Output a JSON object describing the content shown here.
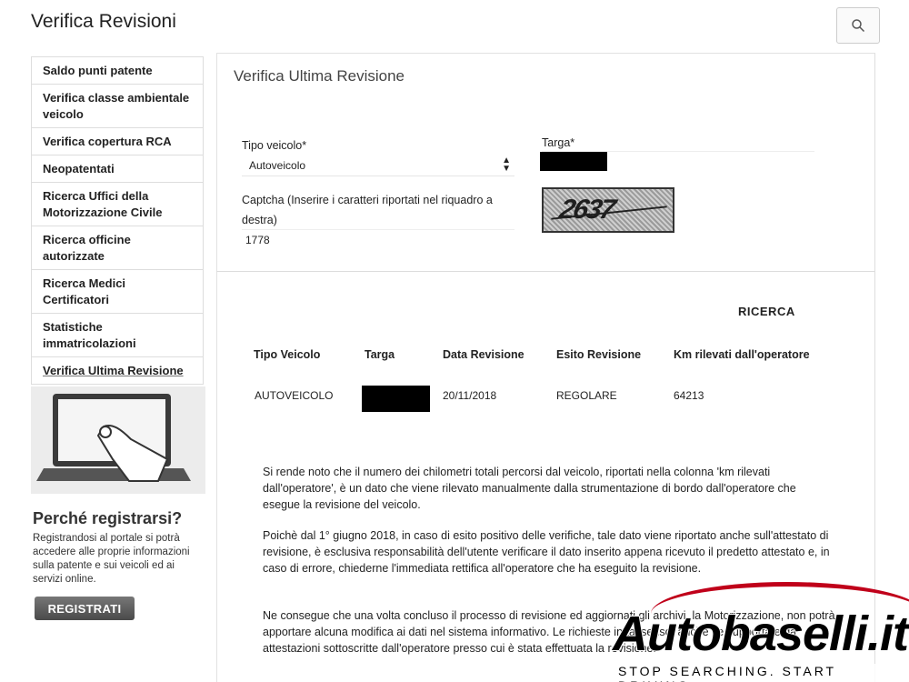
{
  "header": {
    "title": "Verifica Revisioni",
    "search_icon": "search-icon"
  },
  "sidebar": {
    "items": [
      {
        "label": "Saldo punti patente"
      },
      {
        "label": "Verifica classe ambientale veicolo"
      },
      {
        "label": "Verifica copertura RCA"
      },
      {
        "label": "Neopatentati"
      },
      {
        "label": "Ricerca Uffici della Motorizzazione Civile"
      },
      {
        "label": "Ricerca officine autorizzate"
      },
      {
        "label": "Ricerca Medici Certificatori"
      },
      {
        "label": "Statistiche immatricolazioni"
      },
      {
        "label": "Verifica Ultima Revisione"
      }
    ],
    "why_title": "Perché registrarsi?",
    "why_text": "Registrandosi al portale si potrà accedere alle proprie informazioni sulla patente e sui veicoli ed ai servizi online.",
    "register_label": "REGISTRATI"
  },
  "form": {
    "title": "Verifica Ultima Revisione",
    "tipo_label": "Tipo veicolo*",
    "tipo_value": "Autoveicolo",
    "targa_label": "Targa*",
    "captcha_label": "Captcha (Inserire i caratteri riportati nel riquadro a destra)",
    "captcha_value": "1778",
    "captcha_image_text": "2637",
    "search_label": "RICERCA"
  },
  "results": {
    "columns": [
      "Tipo Veicolo",
      "Targa",
      "Data Revisione",
      "Esito Revisione",
      "Km rilevati dall'operatore"
    ],
    "row": {
      "tipo": "AUTOVEICOLO",
      "data": "20/11/2018",
      "esito": "REGOLARE",
      "km": "64213"
    }
  },
  "info": {
    "p1": "Si rende noto che il numero dei chilometri totali percorsi dal veicolo, riportati nella colonna 'km rilevati dall'operatore', è un dato che viene rilevato manualmente dalla strumentazione di bordo dall'operatore che esegue la revisione del veicolo.",
    "p2": "Poichè dal 1° giugno 2018, in caso di esito positivo delle verifiche, tale dato viene riportato anche sull'attestato di revisione, è esclusiva responsabilità dell'utente verificare il dato inserito appena ricevuto il predetto attestato e, in caso di errore, chiederne l'immediata rettifica all'operatore che ha eseguito la revisione.",
    "p3": "Ne consegue che una volta concluso il processo di revisione ed aggiornati gli archivi, la Motorizzazione, non potrà apportare alcuna modifica ai dati nel sistema informativo. Le richieste in tal senso, anche se supportate da attestazioni sottoscritte dall'operatore presso cui è stata effettuata la revisione."
  },
  "watermark": {
    "logo": "Autobaselli.it",
    "tagline": "STOP SEARCHING. START DRIVING."
  },
  "colors": {
    "accent": "#c0001a",
    "redaction": "#000000"
  }
}
